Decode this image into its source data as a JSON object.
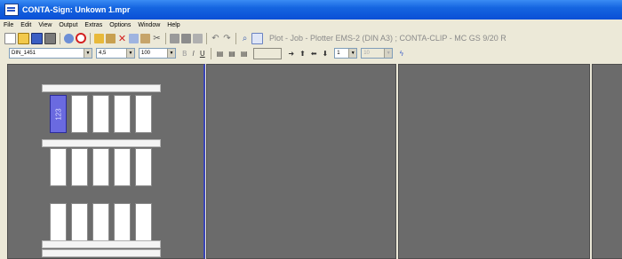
{
  "window": {
    "title": "CONTA-Sign: Unkown 1.mpr"
  },
  "menu": [
    "File",
    "Edit",
    "View",
    "Output",
    "Extras",
    "Options",
    "Window",
    "Help"
  ],
  "toolbar": {
    "status": "Plot - Job - Plotter EMS-2 (DIN A3)  ;  CONTA-CLIP - MC GS 9/20 R"
  },
  "format_bar": {
    "font": "DIN_1451",
    "size": "4,5",
    "zoom": "100",
    "page": "1",
    "page2": "10"
  },
  "canvas": {
    "selected_block_label": "123"
  }
}
